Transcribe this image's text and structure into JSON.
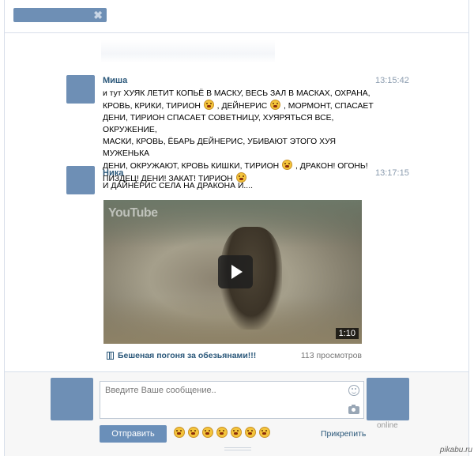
{
  "header": {
    "close_glyph": "✖"
  },
  "messages": [
    {
      "author": "Миша",
      "time": "13:15:42",
      "lines": [
        [
          "и тут ХУЯК ЛЕТИТ КОПЬЁ В МАСКУ, ВЕСЬ ЗАЛ В МАСКАХ, ОХРАНА,"
        ],
        [
          "КРОВЬ, КРИКИ, ТИРИОН ",
          "emoji",
          " , ДЕЙНЕРИС ",
          "emoji",
          " , МОРМОНТ, СПАСАЕТ"
        ],
        [
          "ДЕНИ, ТИРИОН СПАСАЕТ СОВЕТНИЦУ, ХУЯРЯТЬСЯ ВСЕ, ОКРУЖЕНИЕ,"
        ],
        [
          "МАСКИ, КРОВЬ, ЁБАРЬ ДЕЙНЕРИС, УБИВАЮТ ЭТОГО ХУЯ МУЖЕНЬКА"
        ],
        [
          "ДЕНИ, ОКРУЖАЮТ, КРОВЬ КИШКИ, ТИРИОН ",
          "emoji",
          " , ДРАКОН! ОГОНЬ!"
        ],
        [
          "ПИЗДЕЦ! ДЕНИ! ЗАКАТ! ТИРИОН ",
          "emoji"
        ]
      ]
    },
    {
      "author": "Ника",
      "time": "13:17:15",
      "lines": [
        [
          "И ДАЙНЕРИС СЕЛА НА ДРАКОНА И...."
        ]
      ]
    }
  ],
  "video": {
    "logo": "YouTube",
    "duration": "1:10",
    "title": "Бешеная погоня за обезьянами!!!",
    "views": "113 просмотров"
  },
  "composer": {
    "placeholder": "Введите Ваше сообщение..",
    "send_label": "Отправить",
    "attach_label": "Прикрепить",
    "online_label": "online",
    "emoji_count": 7
  },
  "watermark": "pikabu.ru"
}
